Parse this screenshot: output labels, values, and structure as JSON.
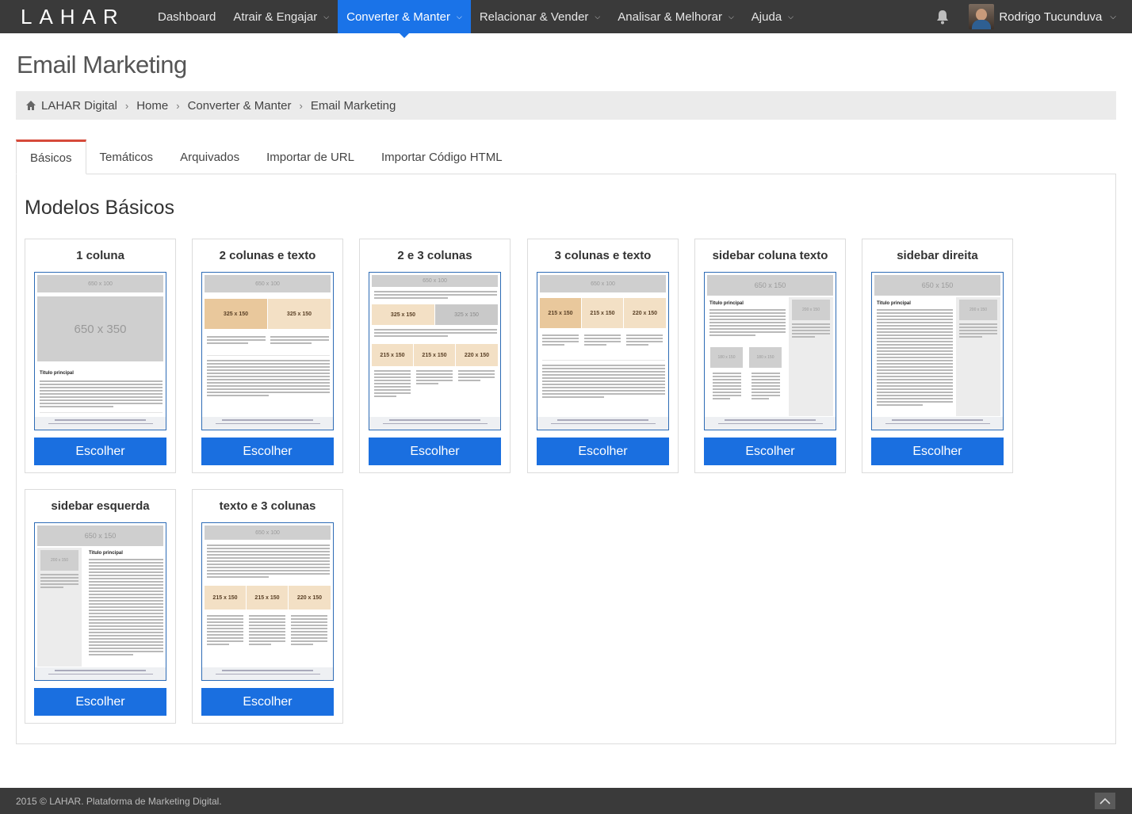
{
  "app": {
    "logo": "LAHAR"
  },
  "nav": {
    "items": [
      {
        "label": "Dashboard",
        "dropdown": false
      },
      {
        "label": "Atrair & Engajar",
        "dropdown": true
      },
      {
        "label": "Converter & Manter",
        "dropdown": true,
        "active": true
      },
      {
        "label": "Relacionar & Vender",
        "dropdown": true
      },
      {
        "label": "Analisar & Melhorar",
        "dropdown": true
      },
      {
        "label": "Ajuda",
        "dropdown": true
      }
    ],
    "notifications_icon": "bell-icon",
    "user_name": "Rodrigo Tucunduva"
  },
  "page": {
    "title": "Email Marketing"
  },
  "breadcrumb": [
    "LAHAR Digital",
    "Home",
    "Converter & Manter",
    "Email Marketing"
  ],
  "tabs": [
    {
      "label": "Básicos",
      "active": true
    },
    {
      "label": "Temáticos"
    },
    {
      "label": "Arquivados"
    },
    {
      "label": "Importar de URL"
    },
    {
      "label": "Importar Código HTML"
    }
  ],
  "section": {
    "title": "Modelos Básicos"
  },
  "templates": [
    {
      "name": "1 coluna",
      "button": "Escolher"
    },
    {
      "name": "2 colunas e texto",
      "button": "Escolher"
    },
    {
      "name": "2 e 3 colunas",
      "button": "Escolher"
    },
    {
      "name": "3 colunas e texto",
      "button": "Escolher"
    },
    {
      "name": "sidebar coluna texto",
      "button": "Escolher"
    },
    {
      "name": "sidebar direita",
      "button": "Escolher"
    },
    {
      "name": "sidebar esquerda",
      "button": "Escolher"
    },
    {
      "name": "texto e 3 colunas",
      "button": "Escolher"
    }
  ],
  "thumb_labels": {
    "w650x100": "650 x 100",
    "w650x350": "650 x 350",
    "w650x150": "650 x 150",
    "w325x150": "325 x 150",
    "w215x150": "215 x 150",
    "w220x150": "220 x 150",
    "w200x150": "200 x 150",
    "w180x150": "180 x 150",
    "titulo": "Titulo principal"
  },
  "footer": {
    "text": "2015 © LAHAR. Plataforma de Marketing Digital."
  },
  "colors": {
    "navbar": "#3a3a3a",
    "active_nav": "#1a73e8",
    "button": "#1a6fe0",
    "tab_accent": "#d64a3a"
  }
}
